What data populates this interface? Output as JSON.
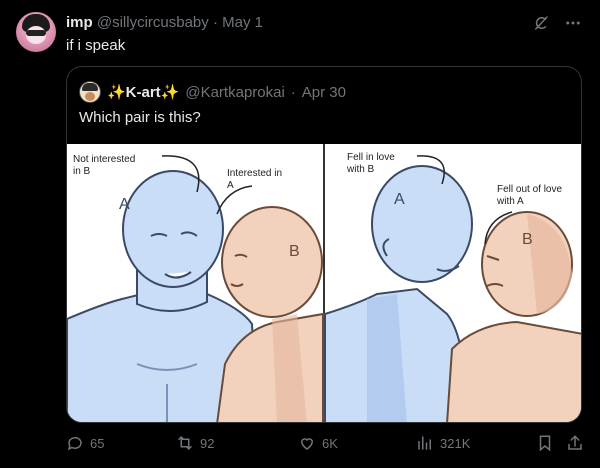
{
  "post": {
    "display_name": "imp",
    "handle": "@sillycircusbaby",
    "separator": "·",
    "date": "May 1",
    "text": "if i speak"
  },
  "quote": {
    "display_name": "✨K-art✨",
    "handle": "@Kartkaprokai",
    "separator": "·",
    "date": "Apr 30",
    "text": "Which pair is this?"
  },
  "artwork": {
    "left_panel": {
      "label_a": "Not interested\nin B",
      "label_b": "Interested in\nA",
      "letter_a": "A",
      "letter_b": "B"
    },
    "right_panel": {
      "label_a": "Fell in love\nwith B",
      "label_b": "Fell out of love\nwith A",
      "letter_a": "A",
      "letter_b": "B"
    }
  },
  "actions": {
    "replies": "65",
    "reposts": "92",
    "likes": "6K",
    "views": "321K"
  },
  "icons": [
    "grok-icon",
    "more-icon",
    "reply-icon",
    "repost-icon",
    "like-icon",
    "views-icon",
    "bookmark-icon",
    "share-icon"
  ],
  "colors": {
    "background": "#000000",
    "text": "#e7e9ea",
    "muted": "#71767b",
    "border": "#2f3336",
    "figure_a": "#c9ddf7",
    "figure_b": "#f3d2bd"
  }
}
